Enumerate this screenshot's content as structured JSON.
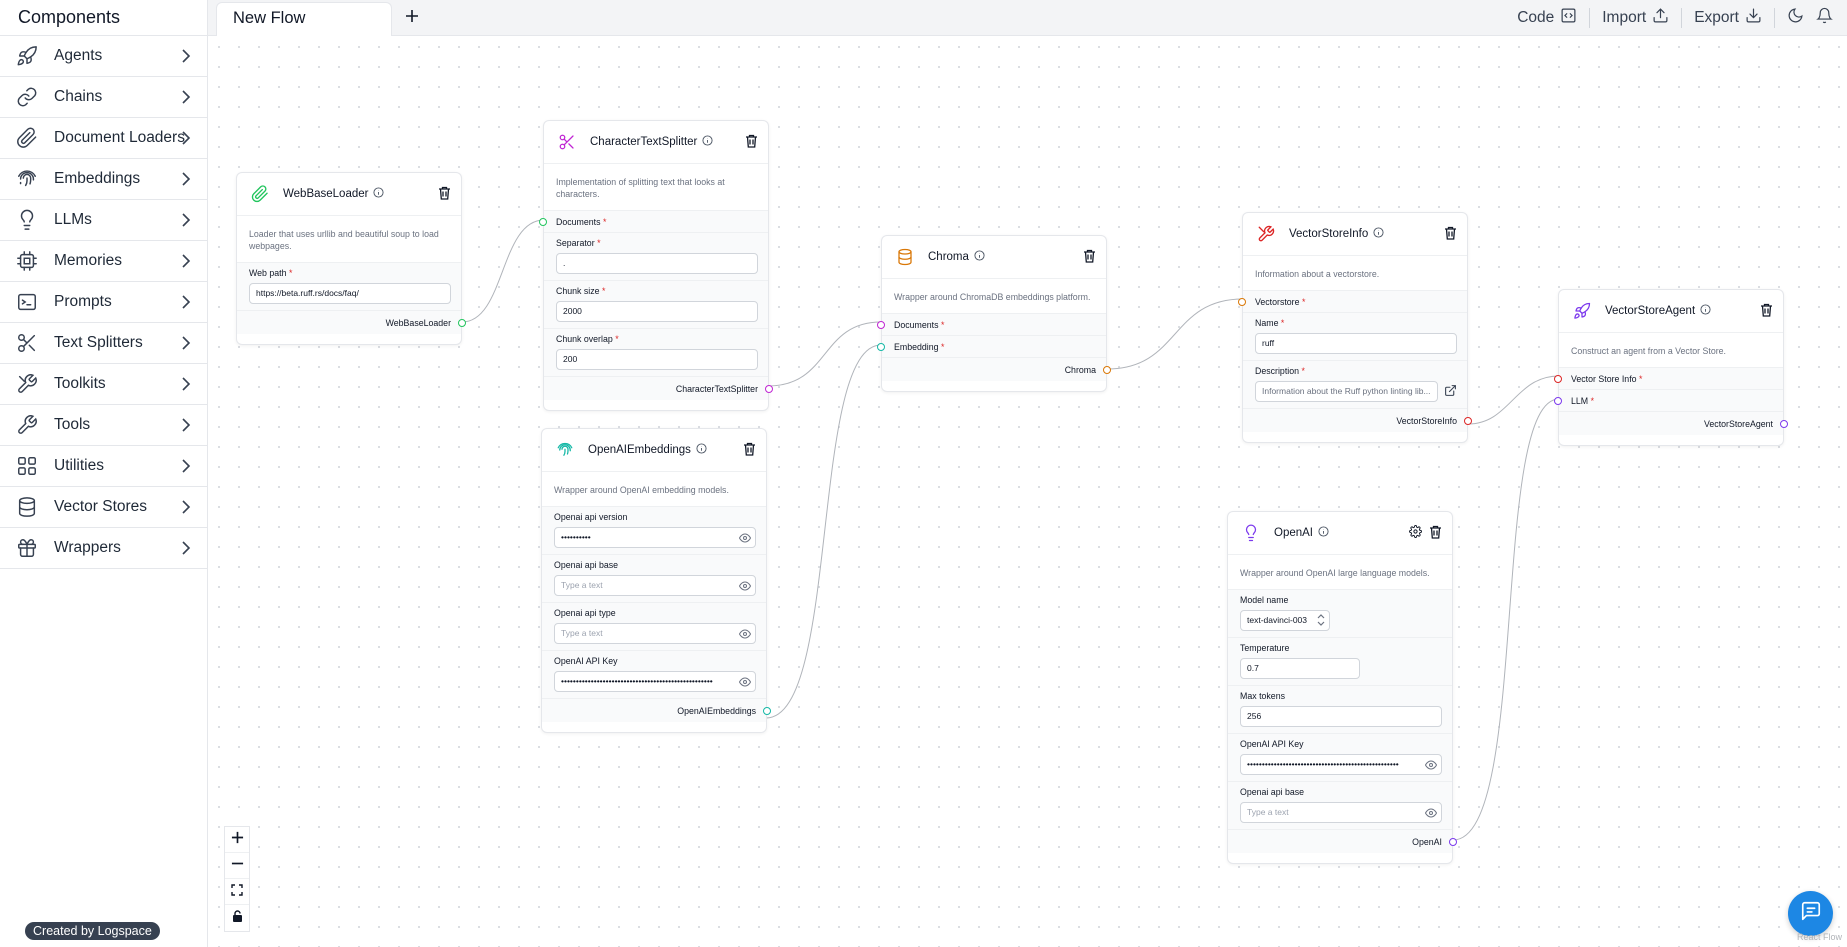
{
  "sidebar": {
    "title": "Components",
    "items": [
      {
        "label": "Agents",
        "icon": "rocket-icon"
      },
      {
        "label": "Chains",
        "icon": "link-icon"
      },
      {
        "label": "Document Loaders",
        "icon": "paperclip-icon"
      },
      {
        "label": "Embeddings",
        "icon": "fingerprint-icon"
      },
      {
        "label": "LLMs",
        "icon": "lightbulb-icon"
      },
      {
        "label": "Memories",
        "icon": "cpu-icon"
      },
      {
        "label": "Prompts",
        "icon": "terminal-icon"
      },
      {
        "label": "Text Splitters",
        "icon": "scissors-icon"
      },
      {
        "label": "Toolkits",
        "icon": "tools-icon"
      },
      {
        "label": "Tools",
        "icon": "wrench-icon"
      },
      {
        "label": "Utilities",
        "icon": "grid-icon"
      },
      {
        "label": "Vector Stores",
        "icon": "database-icon"
      },
      {
        "label": "Wrappers",
        "icon": "gift-icon"
      }
    ],
    "footer_badge": "Created by Logspace"
  },
  "header": {
    "tab_label": "New Flow",
    "code_label": "Code",
    "import_label": "Import",
    "export_label": "Export"
  },
  "nodes": {
    "webbaseloader": {
      "title": "WebBaseLoader",
      "description": "Loader that uses urllib and beautiful soup to load webpages.",
      "web_path_label": "Web path",
      "web_path_value": "https://beta.ruff.rs/docs/faq/",
      "output": "WebBaseLoader"
    },
    "splitter": {
      "title": "CharacterTextSplitter",
      "description": "Implementation of splitting text that looks at characters.",
      "documents_label": "Documents",
      "separator_label": "Separator",
      "separator_value": ".",
      "chunk_size_label": "Chunk size",
      "chunk_size_value": "2000",
      "chunk_overlap_label": "Chunk overlap",
      "chunk_overlap_value": "200",
      "output": "CharacterTextSplitter"
    },
    "embeddings": {
      "title": "OpenAIEmbeddings",
      "description": "Wrapper around OpenAI embedding models.",
      "api_version_label": "Openai api version",
      "api_version_value": "••••••••••",
      "api_base_label": "Openai api base",
      "api_base_placeholder": "Type a text",
      "api_type_label": "Openai api type",
      "api_type_placeholder": "Type a text",
      "api_key_label": "OpenAI API Key",
      "api_key_value": "•••••••••••••••••••••••••••••••••••••••••••••••••••",
      "output": "OpenAIEmbeddings"
    },
    "chroma": {
      "title": "Chroma",
      "description": "Wrapper around ChromaDB embeddings platform.",
      "documents_label": "Documents",
      "embedding_label": "Embedding",
      "output": "Chroma"
    },
    "vsinfo": {
      "title": "VectorStoreInfo",
      "description": "Information about a vectorstore.",
      "vectorstore_label": "Vectorstore",
      "name_label": "Name",
      "name_value": "ruff",
      "description_label": "Description",
      "description_value": "Information about the Ruff python linting lib...",
      "output": "VectorStoreInfo"
    },
    "vsagent": {
      "title": "VectorStoreAgent",
      "description": "Construct an agent from a Vector Store.",
      "vsinfo_label": "Vector Store Info",
      "llm_label": "LLM",
      "output": "VectorStoreAgent"
    },
    "openai": {
      "title": "OpenAI",
      "description": "Wrapper around OpenAI large language models.",
      "model_name_label": "Model name",
      "model_name_value": "text-davinci-003",
      "temperature_label": "Temperature",
      "temperature_value": "0.7",
      "max_tokens_label": "Max tokens",
      "max_tokens_value": "256",
      "api_key_label": "OpenAI API Key",
      "api_key_value": "•••••••••••••••••••••••••••••••••••••••••••••••••••",
      "api_base_label": "Openai api base",
      "api_base_placeholder": "Type a text",
      "output": "OpenAI"
    }
  },
  "required_marker": "*",
  "watermark": "React Flow",
  "colors": {
    "green": "#22c55e",
    "pink": "#c026d3",
    "teal": "#14b8a6",
    "orange": "#d97706",
    "red": "#dc2626",
    "purple": "#7c3aed",
    "chat": "#1d87e4"
  }
}
